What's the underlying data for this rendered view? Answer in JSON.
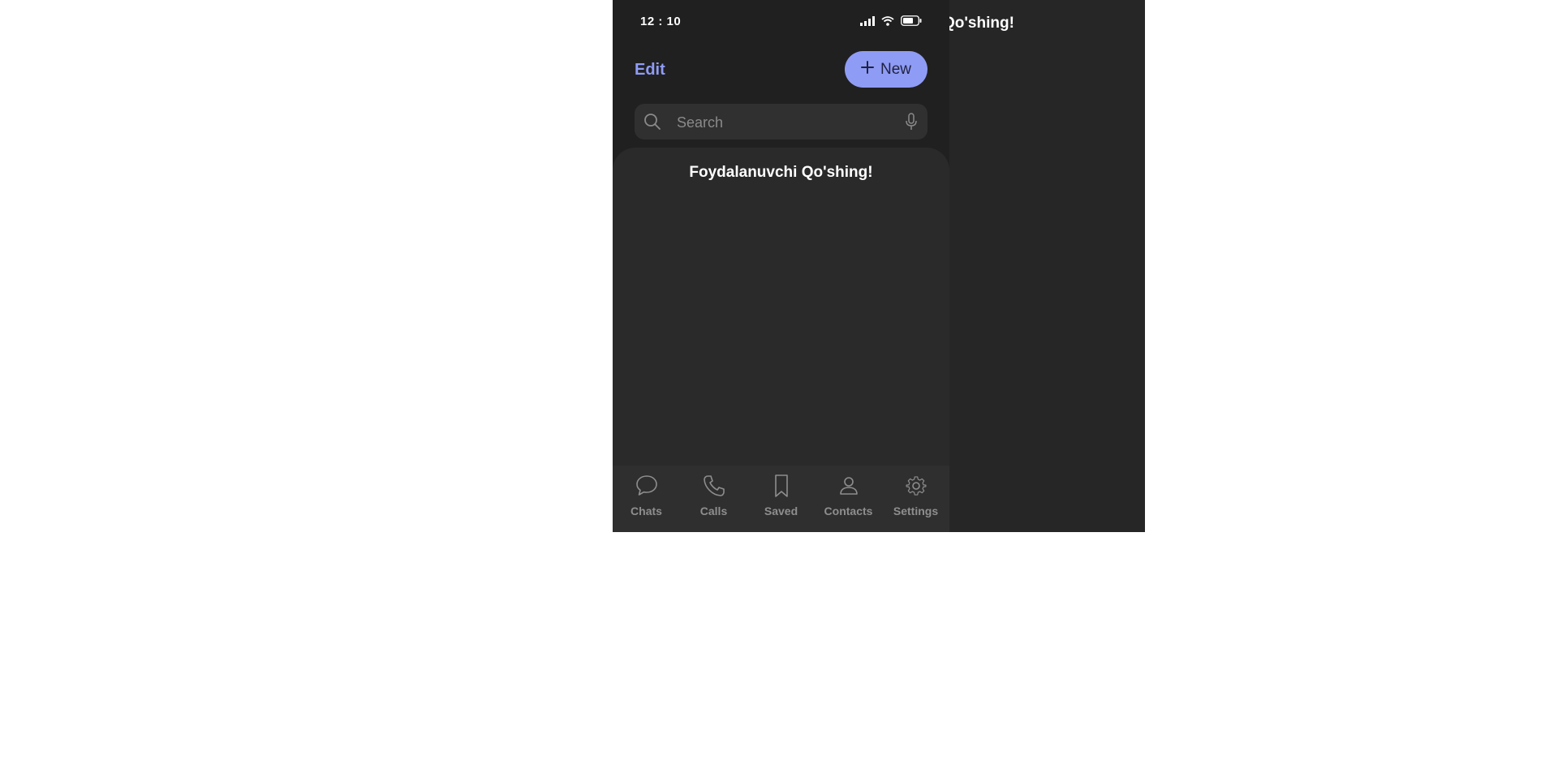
{
  "right_panel": {
    "title": "Qo'shing!"
  },
  "status_bar": {
    "time": "12 : 10",
    "icons": [
      "signal-icon",
      "wifi-icon",
      "battery-icon"
    ]
  },
  "header": {
    "edit_label": "Edit",
    "new_label": "New",
    "new_icon": "plus-icon"
  },
  "search": {
    "placeholder": "Search",
    "value": "",
    "icon": "search-icon",
    "mic_icon": "microphone-icon"
  },
  "chat_list": {
    "empty_message": "Foydalanuvchi Qo'shing!"
  },
  "tab_bar": {
    "items": [
      {
        "label": "Chats",
        "icon": "chat-bubble-icon"
      },
      {
        "label": "Calls",
        "icon": "phone-icon"
      },
      {
        "label": "Saved",
        "icon": "bookmark-icon"
      },
      {
        "label": "Contacts",
        "icon": "person-icon"
      },
      {
        "label": "Settings",
        "icon": "gear-icon"
      }
    ]
  },
  "colors": {
    "accent": "#8f9cf5",
    "background": "#202020",
    "panel": "#262626",
    "sheet": "#2a2a2a",
    "tab_bar": "#2f2f2f",
    "muted_text": "#8e8e8e"
  }
}
